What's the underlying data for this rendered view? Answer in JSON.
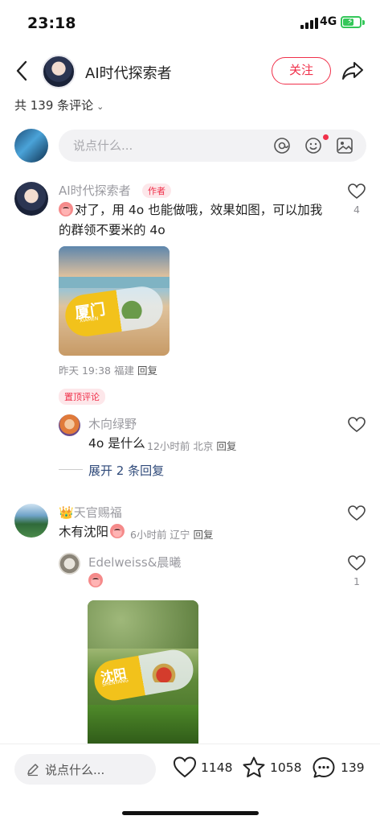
{
  "status": {
    "time": "23:18",
    "network": "4G"
  },
  "header": {
    "name": "AI时代探索者",
    "follow_label": "关注"
  },
  "comments_summary": {
    "count_label": "共 139 条评论"
  },
  "composer": {
    "placeholder": "说点什么..."
  },
  "comments": [
    {
      "name": "AI时代探索者",
      "badge": "作者",
      "text_line1": "对了，用 4o 也能做哦，效果如图，可以加我",
      "text_line2": "的群领不要米的 4o",
      "image_text": "厦门",
      "image_subtext": "XIAMEN",
      "meta": "昨天 19:38 福建",
      "reply_label": "回复",
      "likes": "4",
      "pinned_label": "置顶评论",
      "replies": [
        {
          "name": "木向绿野",
          "text": "4o 是什么",
          "meta": "12小时前 北京",
          "reply_label": "回复"
        }
      ],
      "expand_label": "展开 2 条回复"
    },
    {
      "name": "天官赐福",
      "text": "木有沈阳",
      "meta": "6小时前 辽宁",
      "reply_label": "回复",
      "replies": [
        {
          "name": "Edelweiss&晨曦",
          "likes": "1",
          "image_text": "沈阳",
          "image_subtext": "SHENYANG"
        }
      ]
    }
  ],
  "bottom_bar": {
    "placeholder": "说点什么...",
    "likes": "1148",
    "stars": "1058",
    "comments": "139"
  },
  "colors": {
    "accent": "#f0304a",
    "link": "#2f4a7a",
    "battery": "#34c759"
  }
}
